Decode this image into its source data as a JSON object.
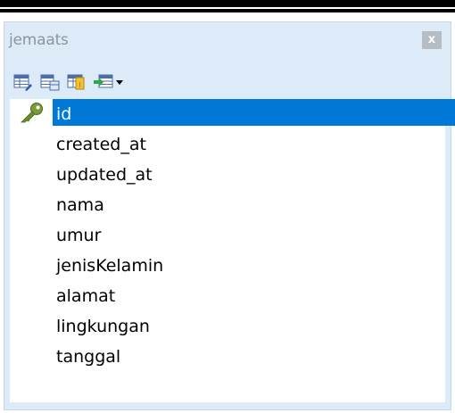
{
  "panel": {
    "title": "jemaats",
    "close_label": "x"
  },
  "toolbar": {
    "buttons": [
      {
        "icon": "table-edit-icon"
      },
      {
        "icon": "table-view-icon"
      },
      {
        "icon": "table-key-icon"
      },
      {
        "icon": "table-export-icon"
      }
    ],
    "dropdown_icon": "chevron-down-icon"
  },
  "fields": [
    {
      "name": "id",
      "primary_key": true,
      "selected": true
    },
    {
      "name": "created_at"
    },
    {
      "name": "updated_at"
    },
    {
      "name": "nama"
    },
    {
      "name": "umur"
    },
    {
      "name": "jenisKelamin"
    },
    {
      "name": "alamat"
    },
    {
      "name": "lingkungan"
    },
    {
      "name": "tanggal"
    }
  ],
  "colors": {
    "selection": "#0078d7",
    "panel_bg": "#ddeaf7",
    "title_text": "#8c96a0"
  }
}
